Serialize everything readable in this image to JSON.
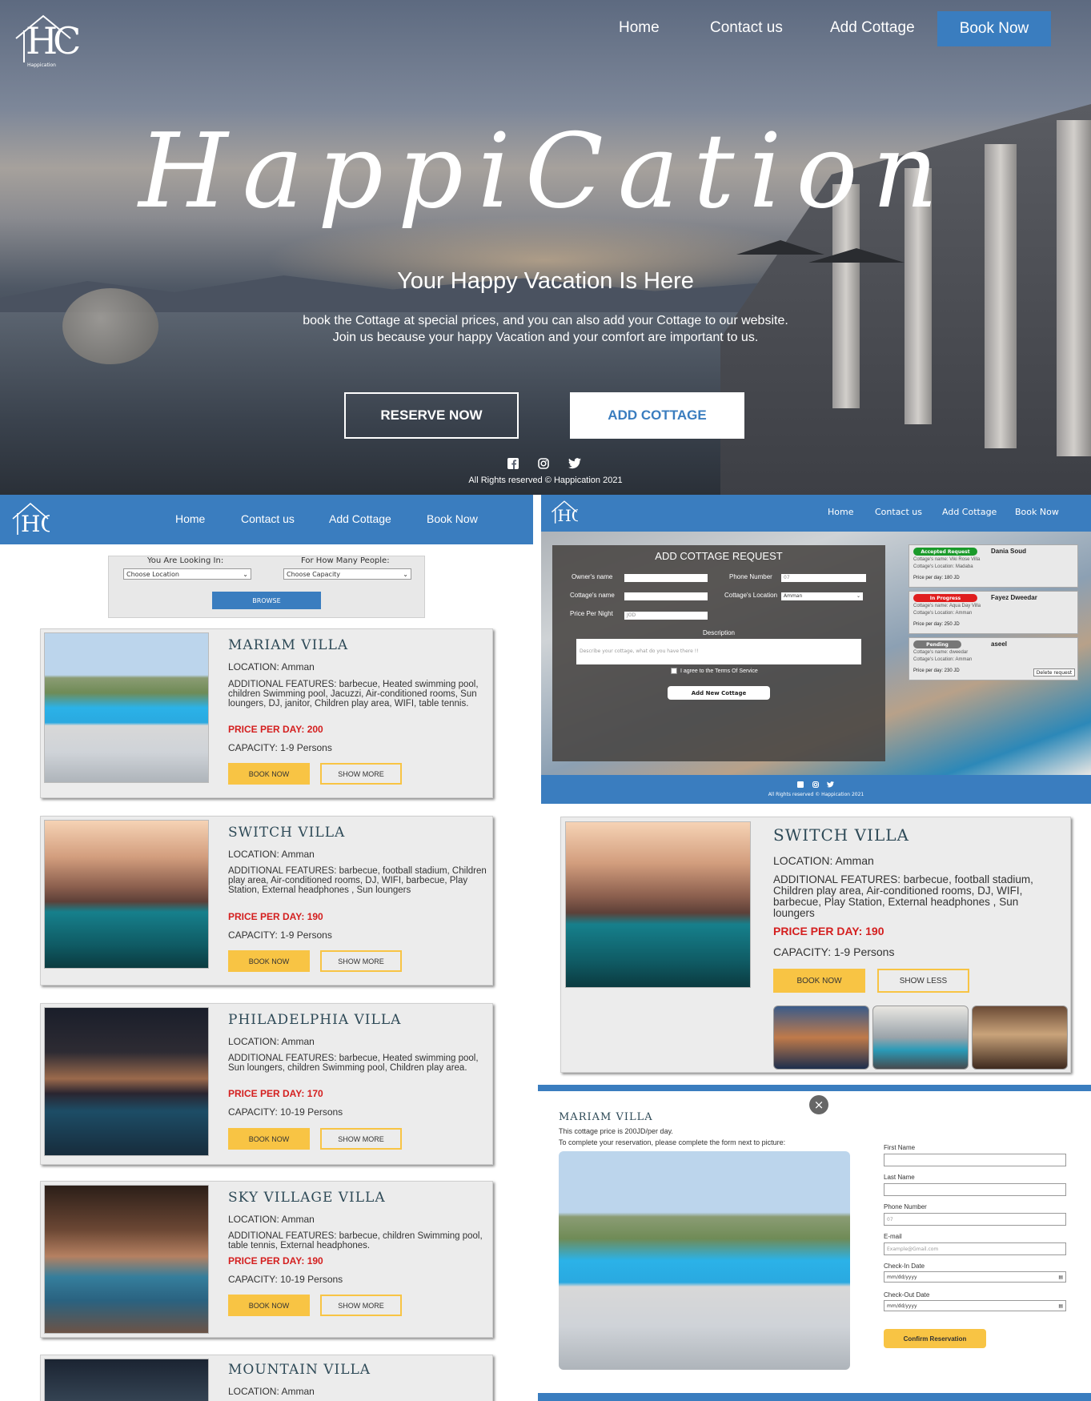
{
  "hero": {
    "logo_text": "HC",
    "logo_sub": "Happication",
    "nav": [
      "Home",
      "Contact us",
      "Add Cottage",
      "Book Now"
    ],
    "brand": "HappiCation",
    "tagline": "Your Happy Vacation Is Here",
    "desc_line1": "book the Cottage at special prices, and you can also add your Cottage to our website.",
    "desc_line2": "Join us because your happy Vacation and your comfort are important to us.",
    "reserve_btn": "RESERVE NOW",
    "add_btn": "ADD COTTAGE",
    "copyright": "All Rights reserved © Happication 2021",
    "social_icons": [
      "facebook-icon",
      "instagram-icon",
      "twitter-icon"
    ]
  },
  "browse_panel": {
    "nav": [
      "Home",
      "Contact us",
      "Add Cottage",
      "Book Now"
    ],
    "looking_label": "You Are Looking In:",
    "people_label": "For How Many People:",
    "location_select": "Choose Location",
    "capacity_select": "Choose Capacity",
    "browse_btn": "BROWSE"
  },
  "villas": [
    {
      "title": "MARIAM VILLA",
      "location": "LOCATION: Amman",
      "features": "ADDITIONAL FEATURES: barbecue, Heated swimming pool, children Swimming pool, Jacuzzi, Air-conditioned rooms, Sun loungers, DJ, janitor, Children play area, WIFI, table tennis.",
      "price": "PRICE PER DAY: 200",
      "capacity": "CAPACITY: 1-9 Persons",
      "book": "BOOK NOW",
      "more": "SHOW MORE"
    },
    {
      "title": "SWITCH VILLA",
      "location": "LOCATION: Amman",
      "features": "ADDITIONAL FEATURES: barbecue, football stadium, Children play area, Air-conditioned rooms, DJ, WIFI, barbecue, Play Station, External headphones , Sun loungers",
      "price": "PRICE PER DAY: 190",
      "capacity": "CAPACITY: 1-9 Persons",
      "book": "BOOK NOW",
      "more": "SHOW MORE"
    },
    {
      "title": "PHILADELPHIA VILLA",
      "location": "LOCATION: Amman",
      "features": "ADDITIONAL FEATURES: barbecue, Heated swimming pool, Sun loungers, children Swimming pool, Children play area.",
      "price": "PRICE PER DAY: 170",
      "capacity": "CAPACITY: 10-19 Persons",
      "book": "BOOK NOW",
      "more": "SHOW MORE"
    },
    {
      "title": "SKY VILLAGE VILLA",
      "location": "LOCATION: Amman",
      "features": "ADDITIONAL FEATURES: barbecue, children Swimming pool, table tennis, External headphones.",
      "price": "PRICE PER DAY: 190",
      "capacity": "CAPACITY: 10-19 Persons",
      "book": "BOOK NOW",
      "more": "SHOW MORE"
    },
    {
      "title": "MOUNTAIN VILLA",
      "location": "LOCATION: Amman"
    }
  ],
  "add_cottage": {
    "nav": [
      "Home",
      "Contact us",
      "Add Cottage",
      "Book Now"
    ],
    "title": "ADD COTTAGE REQUEST",
    "owner_label": "Owner's name",
    "phone_label": "Phone Number",
    "phone_placeholder": "07",
    "cottage_name_label": "Cottage's name",
    "location_label": "Cottage's Location",
    "location_value": "Amman",
    "price_label": "Price Per Night",
    "price_placeholder": "JOD",
    "desc_label": "Description",
    "desc_placeholder": "Describe your cottage, what do you have there !!",
    "terms": "I agree to the Terms Of Service",
    "submit": "Add New Cottage",
    "copyright": "All Rights reserved © Happication 2021",
    "requests": [
      {
        "status": "Accepted Request",
        "color": "#1a9a2a",
        "name": "Dania Soud",
        "cottage": "Cottage's name: Viki Rose Villa",
        "location": "Cottage's Location: Madaba",
        "price": "Price per day: 180 JD"
      },
      {
        "status": "In Progress",
        "color": "#e01e1e",
        "name": "Fayez Dweedar",
        "cottage": "Cottage's name: Aqua Day Villa",
        "location": "Cottage's Location: Amman",
        "price": "Price per day: 250 JD"
      },
      {
        "status": "Pending",
        "color": "#777777",
        "name": "aseel",
        "cottage": "Cottage's name: dweedar",
        "location": "Cottage's Location: Amman",
        "price": "Price per day: 230 JD",
        "delete": "Delete request"
      }
    ]
  },
  "switch_detail": {
    "title": "SWITCH VILLA",
    "location": "LOCATION: Amman",
    "features": "ADDITIONAL FEATURES: barbecue, football stadium, Children play area, Air-conditioned rooms, DJ, WIFI, barbecue, Play Station, External headphones , Sun loungers",
    "price": "PRICE PER DAY: 190",
    "capacity": "CAPACITY: 1-9 Persons",
    "book": "BOOK NOW",
    "less": "SHOW LESS"
  },
  "reservation": {
    "close": "×",
    "title": "MARIAM VILLA",
    "price_line": "This cottage price is 200JD/per day.",
    "instructions": "To complete your reservation, please complete the form next to picture:",
    "first_name": "First Name",
    "last_name": "Last Name",
    "phone": "Phone Number",
    "phone_placeholder": "07",
    "email": "E-mail",
    "email_placeholder": "Example@Gmail.com",
    "checkin": "Check-In Date",
    "checkout": "Check-Out Date",
    "date_placeholder": "mm/dd/yyyy",
    "confirm": "Confirm Reservation"
  },
  "colors": {
    "brand_blue": "#3a7dbf",
    "yellow": "#f8c444",
    "price_red": "#d41f1f"
  }
}
